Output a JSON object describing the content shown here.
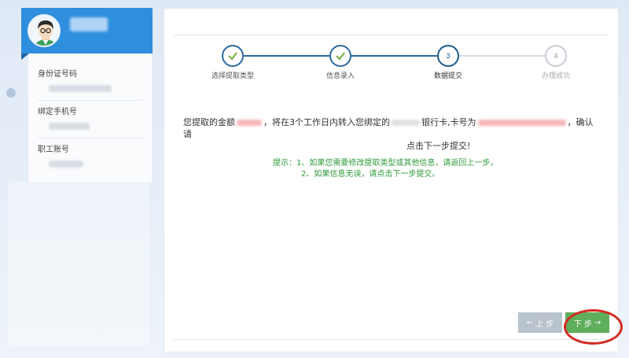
{
  "sidebar": {
    "fields": [
      {
        "label": "身份证号码"
      },
      {
        "label": "绑定手机号"
      },
      {
        "label": "职工账号"
      }
    ]
  },
  "steps": [
    {
      "number": "1",
      "label": "选择提取类型",
      "status": "done"
    },
    {
      "number": "2",
      "label": "信息录入",
      "status": "done"
    },
    {
      "number": "3",
      "label": "数据提交",
      "status": "current"
    },
    {
      "number": "4",
      "label": "办理成功",
      "status": "pending"
    }
  ],
  "message": {
    "part1": "您提取的金额",
    "part2": "，将在3个工作日内转入您绑定的",
    "part3": "银行卡,卡号为",
    "part4": "，确认请",
    "part5": "点击下一步提交!"
  },
  "tips": {
    "line1": "提示：1、如果您需要修改提取类型或其他信息，请返回上一步。",
    "line2": "2、如果信息无误，请点击下一步提交。"
  },
  "buttons": {
    "prev_label": "上 步",
    "next_label": "下 步"
  },
  "colors": {
    "header_blue": "#2f8fde",
    "step_done": "#7cb342",
    "step_current": "#1f5a8c",
    "step_pending": "#c9ced6",
    "tip_green": "#2e9a3a",
    "next_button": "#5fae5c",
    "prev_button": "#b9c3cc",
    "highlight": "#d42a22"
  }
}
